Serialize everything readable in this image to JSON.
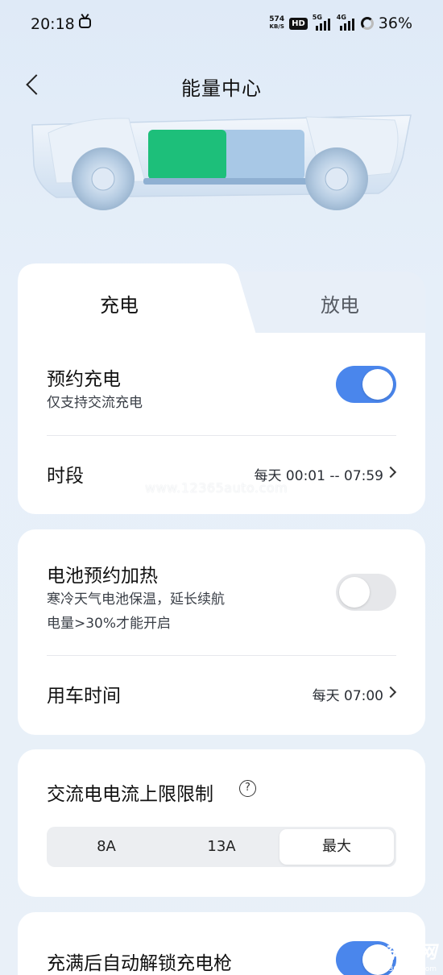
{
  "status_bar": {
    "time": "20:18",
    "speed_value": "574",
    "speed_unit": "KB/S",
    "hd_badge": "HD",
    "net1_label": "5G",
    "net2_label": "4G",
    "battery_percent": "36%"
  },
  "header": {
    "title": "能量中心"
  },
  "vehicle": {
    "battery_level": 0.5,
    "colors": {
      "charged": "#1dbf7a",
      "empty": "#a8c8e6"
    }
  },
  "tabs": {
    "charge": "充电",
    "discharge": "放电"
  },
  "scheduled_charging": {
    "title": "预约充电",
    "subtitle": "仅支持交流充电",
    "enabled": true,
    "period_label": "时段",
    "period_value": "每天 00:01 -- 07:59"
  },
  "battery_preheat": {
    "title": "电池预约加热",
    "subtitle_line1": "寒冷天气电池保温，延长续航",
    "subtitle_line2": "电量>30%才能开启",
    "enabled": false,
    "time_label": "用车时间",
    "time_value": "每天 07:00"
  },
  "ac_current_limit": {
    "title": "交流电电流上限限制",
    "help": "?",
    "options": [
      "8A",
      "13A",
      "最大"
    ],
    "selected": "最大"
  },
  "auto_unlock": {
    "title": "充满后自动解锁充电枪",
    "enabled": true
  },
  "watermark": {
    "text": "www.12365auto.com",
    "logo_text": "车质网",
    "logo_url": "12365auto.com"
  },
  "colors": {
    "accent": "#4a86ec",
    "toggle_off": "#e6e7ea",
    "background": "#e6eff9"
  }
}
